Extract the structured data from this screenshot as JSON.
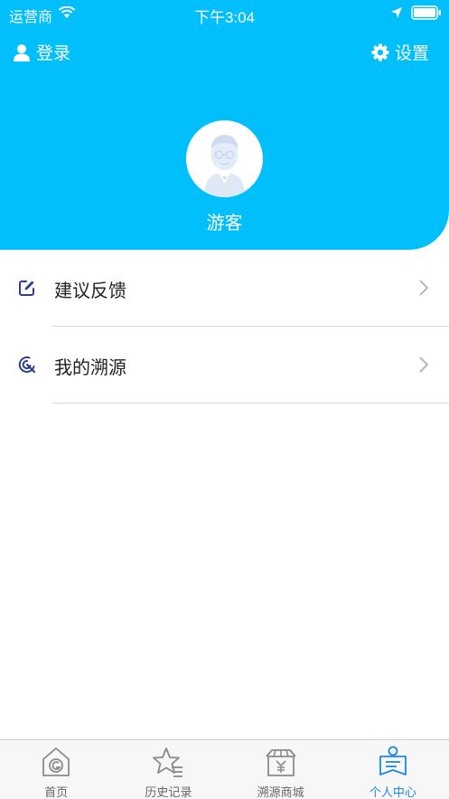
{
  "status_bar": {
    "carrier": "运营商",
    "time": "下午3:04"
  },
  "header": {
    "login_label": "登录",
    "settings_label": "设置",
    "username": "游客",
    "background_color": "#00BFFB"
  },
  "menu": {
    "items": [
      {
        "label": "建议反馈",
        "icon": "edit-icon"
      },
      {
        "label": "我的溯源",
        "icon": "trace-icon"
      }
    ]
  },
  "tabbar": {
    "items": [
      {
        "label": "首页",
        "icon": "home-icon",
        "active": false
      },
      {
        "label": "历史记录",
        "icon": "history-star-icon",
        "active": false
      },
      {
        "label": "溯源商城",
        "icon": "shop-icon",
        "active": false
      },
      {
        "label": "个人中心",
        "icon": "profile-icon",
        "active": true
      }
    ],
    "active_color": "#1e88e5"
  }
}
